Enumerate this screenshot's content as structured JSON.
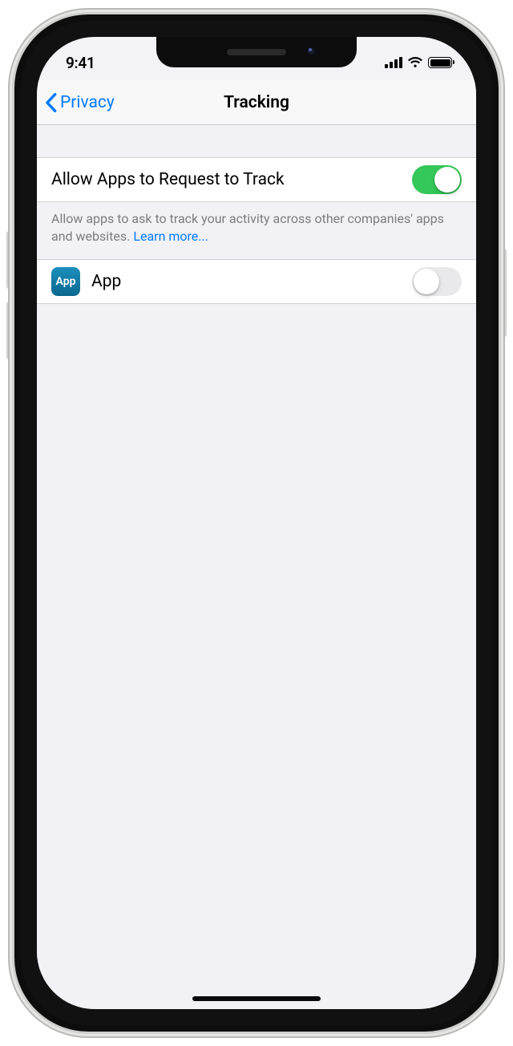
{
  "status": {
    "time": "9:41"
  },
  "nav": {
    "back_label": "Privacy",
    "title": "Tracking"
  },
  "main": {
    "allow_track_label": "Allow Apps to Request to Track",
    "allow_track_on": true,
    "footer_text": "Allow apps to ask to track your activity across other companies' apps and websites. ",
    "footer_link": "Learn more..."
  },
  "apps": [
    {
      "icon_label": "App",
      "name": "App",
      "on": false
    }
  ]
}
